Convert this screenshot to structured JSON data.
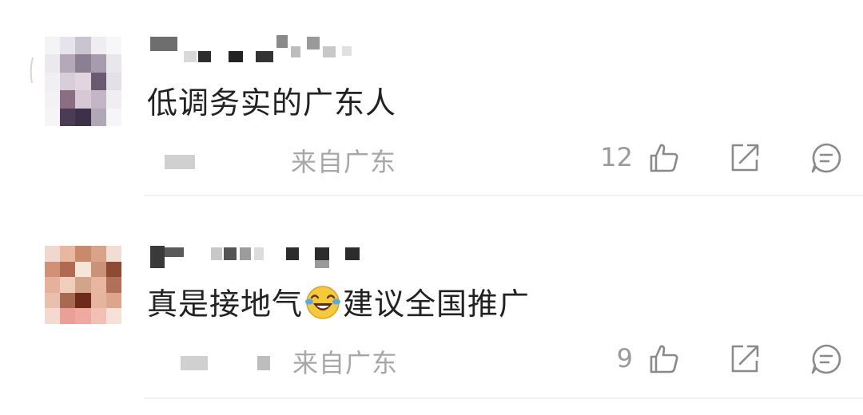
{
  "comments": [
    {
      "text": "低调务实的广东人",
      "location": "来自广东",
      "like_count": "12",
      "icons": {
        "like": "thumbs-up-icon",
        "share": "share-icon",
        "reply": "comment-icon"
      }
    },
    {
      "text_before_emoji": "真是接地气",
      "emoji": "laughing-tears-emoji",
      "text_after_emoji": "建议全国推广",
      "location": "来自广东",
      "like_count": "9",
      "icons": {
        "like": "thumbs-up-icon",
        "share": "share-icon",
        "reply": "comment-icon"
      }
    }
  ],
  "colors": {
    "text": "#222222",
    "meta": "#a7a7a7",
    "icon": "#8a8a8a",
    "divider": "#f2f2f2"
  }
}
